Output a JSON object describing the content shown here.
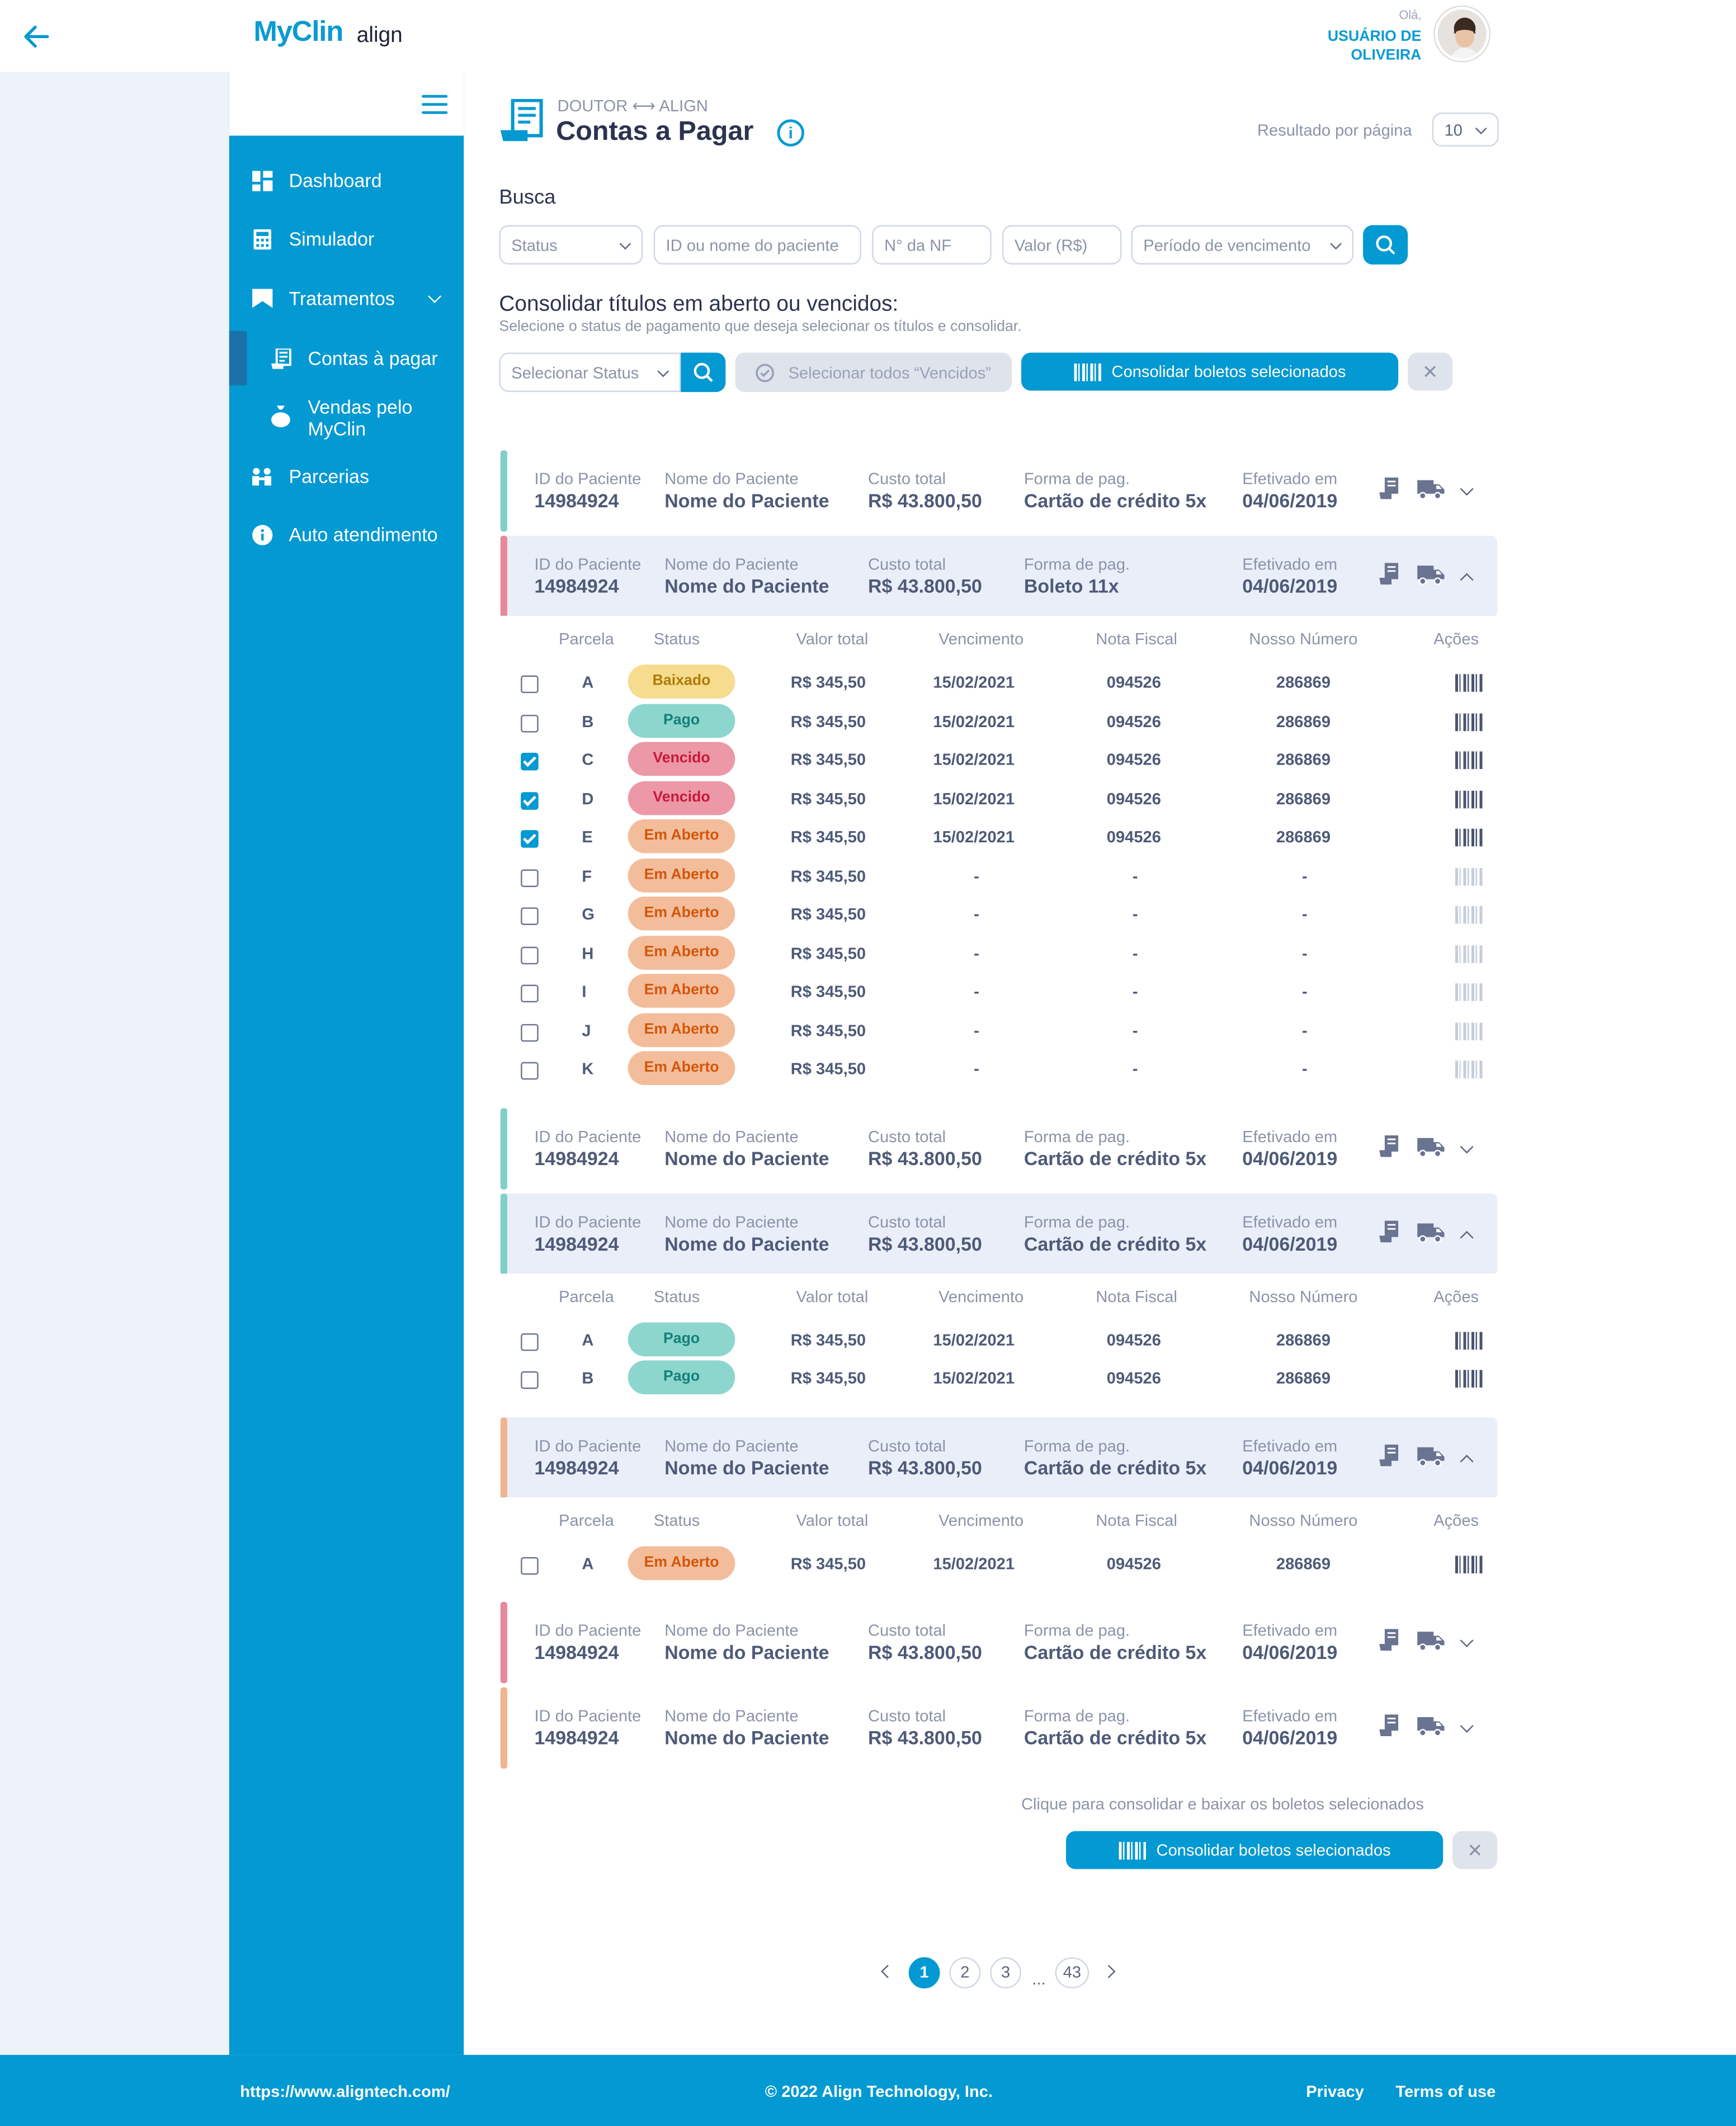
{
  "header": {
    "brand": "MyClin",
    "brand_partner": "align",
    "greeting": "Olá,",
    "user_name": "USUÁRIO DE OLIVEIRA"
  },
  "sidebar": {
    "items": [
      {
        "label": "Dashboard",
        "icon": "dashboard-icon"
      },
      {
        "label": "Simulador",
        "icon": "calculator-icon"
      },
      {
        "label": "Tratamentos",
        "icon": "bookmark-icon"
      },
      {
        "label": "Contas à pagar",
        "icon": "receipt-icon"
      },
      {
        "label": "Vendas pelo MyClin",
        "icon": "money-bag-icon"
      },
      {
        "label": "Parcerias",
        "icon": "handshake-icon"
      },
      {
        "label": "Auto atendimento",
        "icon": "info-icon"
      }
    ]
  },
  "page": {
    "breadcrumb": "DOUTOR ⟷ ALIGN",
    "title": "Contas a Pagar",
    "results_per_page_label": "Resultado por página",
    "results_per_page_value": "10"
  },
  "search": {
    "title": "Busca",
    "status_placeholder": "Status",
    "patient_placeholder": "ID ou nome do paciente",
    "nf_placeholder": "N° da NF",
    "value_placeholder": "Valor (R$)",
    "period_placeholder": "Período de vencimento"
  },
  "consolidate": {
    "title": "Consolidar títulos em aberto ou vencidos:",
    "subtitle": "Selecione o status de pagamento que deseja selecionar os títulos e consolidar.",
    "status_placeholder": "Selecionar Status",
    "select_all_label": "Selecionar todos “Vencidos”",
    "consolidate_label": "Consolidar boletos selecionados"
  },
  "card_labels": {
    "id": "ID do Paciente",
    "name": "Nome do Paciente",
    "total": "Custo total",
    "payment": "Forma de pag.",
    "date": "Efetivado em"
  },
  "table_headers": {
    "parcela": "Parcela",
    "status": "Status",
    "valor": "Valor total",
    "vencimento": "Vencimento",
    "nf": "Nota Fiscal",
    "nosso": "Nosso Número",
    "acoes": "Ações"
  },
  "cards": [
    {
      "id": "14984924",
      "name": "Nome do Paciente",
      "total": "R$ 43.800,50",
      "payment": "Cartão de crédito 5x",
      "date": "04/06/2019",
      "color": "#7fd0c7",
      "open": false
    },
    {
      "id": "14984924",
      "name": "Nome do Paciente",
      "total": "R$ 43.800,50",
      "payment": "Boleto 11x",
      "date": "04/06/2019",
      "color": "#e8889a",
      "open": true,
      "rows": [
        {
          "parcela": "A",
          "status": "Baixado",
          "valor": "R$ 345,50",
          "venc": "15/02/2021",
          "nf": "094526",
          "nosso": "286869",
          "checked": false
        },
        {
          "parcela": "B",
          "status": "Pago",
          "valor": "R$ 345,50",
          "venc": "15/02/2021",
          "nf": "094526",
          "nosso": "286869",
          "checked": false
        },
        {
          "parcela": "C",
          "status": "Vencido",
          "valor": "R$ 345,50",
          "venc": "15/02/2021",
          "nf": "094526",
          "nosso": "286869",
          "checked": true
        },
        {
          "parcela": "D",
          "status": "Vencido",
          "valor": "R$ 345,50",
          "venc": "15/02/2021",
          "nf": "094526",
          "nosso": "286869",
          "checked": true
        },
        {
          "parcela": "E",
          "status": "Em Aberto",
          "valor": "R$ 345,50",
          "venc": "15/02/2021",
          "nf": "094526",
          "nosso": "286869",
          "checked": true
        },
        {
          "parcela": "F",
          "status": "Em Aberto",
          "valor": "R$ 345,50",
          "venc": "-",
          "nf": "-",
          "nosso": "-",
          "checked": false
        },
        {
          "parcela": "G",
          "status": "Em Aberto",
          "valor": "R$ 345,50",
          "venc": "-",
          "nf": "-",
          "nosso": "-",
          "checked": false
        },
        {
          "parcela": "H",
          "status": "Em Aberto",
          "valor": "R$ 345,50",
          "venc": "-",
          "nf": "-",
          "nosso": "-",
          "checked": false
        },
        {
          "parcela": "I",
          "status": "Em Aberto",
          "valor": "R$ 345,50",
          "venc": "-",
          "nf": "-",
          "nosso": "-",
          "checked": false
        },
        {
          "parcela": "J",
          "status": "Em Aberto",
          "valor": "R$ 345,50",
          "venc": "-",
          "nf": "-",
          "nosso": "-",
          "checked": false
        },
        {
          "parcela": "K",
          "status": "Em Aberto",
          "valor": "R$ 345,50",
          "venc": "-",
          "nf": "-",
          "nosso": "-",
          "checked": false
        }
      ]
    },
    {
      "id": "14984924",
      "name": "Nome do Paciente",
      "total": "R$ 43.800,50",
      "payment": "Cartão de crédito 5x",
      "date": "04/06/2019",
      "color": "#7fd0c7",
      "open": false
    },
    {
      "id": "14984924",
      "name": "Nome do Paciente",
      "total": "R$ 43.800,50",
      "payment": "Cartão de crédito 5x",
      "date": "04/06/2019",
      "color": "#7fd0c7",
      "open": true,
      "rows": [
        {
          "parcela": "A",
          "status": "Pago",
          "valor": "R$ 345,50",
          "venc": "15/02/2021",
          "nf": "094526",
          "nosso": "286869",
          "checked": false
        },
        {
          "parcela": "B",
          "status": "Pago",
          "valor": "R$ 345,50",
          "venc": "15/02/2021",
          "nf": "094526",
          "nosso": "286869",
          "checked": false
        }
      ]
    },
    {
      "id": "14984924",
      "name": "Nome do Paciente",
      "total": "R$ 43.800,50",
      "payment": "Cartão de crédito 5x",
      "date": "04/06/2019",
      "color": "#f0b48e",
      "open": true,
      "rows": [
        {
          "parcela": "A",
          "status": "Em Aberto",
          "valor": "R$ 345,50",
          "venc": "15/02/2021",
          "nf": "094526",
          "nosso": "286869",
          "checked": false
        }
      ]
    },
    {
      "id": "14984924",
      "name": "Nome do Paciente",
      "total": "R$ 43.800,50",
      "payment": "Cartão de crédito 5x",
      "date": "04/06/2019",
      "color": "#e8889a",
      "open": false
    },
    {
      "id": "14984924",
      "name": "Nome do Paciente",
      "total": "R$ 43.800,50",
      "payment": "Cartão de crédito 5x",
      "date": "04/06/2019",
      "color": "#f0b48e",
      "open": false
    }
  ],
  "bottom": {
    "hint": "Clique para consolidar e baixar os boletos selecionados",
    "consolidate_label": "Consolidar boletos selecionados"
  },
  "pagination": {
    "pages": [
      "1",
      "2",
      "3"
    ],
    "ellipsis": "...",
    "last": "43",
    "current": "1"
  },
  "footer": {
    "url": "https://www.aligntech.com/",
    "copyright": "© 2022 Align Technology, Inc.",
    "privacy": "Privacy",
    "terms": "Terms of use"
  },
  "colors": {
    "primary": "#0399d2",
    "baixado": "#f5dc8e",
    "pago": "#8dd6cd",
    "vencido": "#ec98a6",
    "em_aberto": "#f3bd9b"
  }
}
